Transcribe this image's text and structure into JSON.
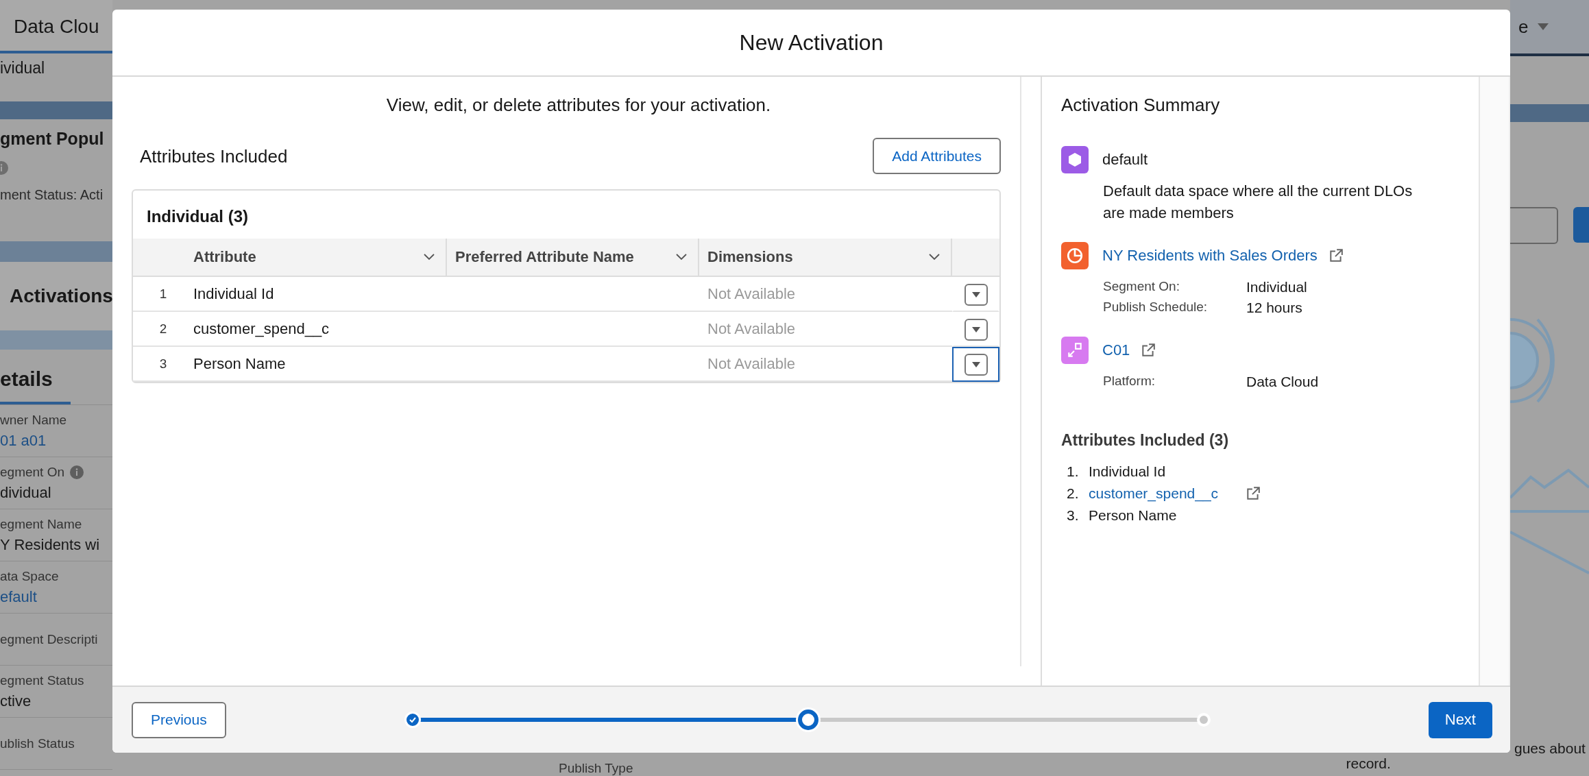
{
  "background": {
    "app_title": "Data Clou",
    "record_type": "ividual",
    "page_title": "gment Popul",
    "status_line": "ment Status: Acti",
    "activations_heading": "Activations",
    "details_tab": "etails",
    "fields": [
      {
        "label": "wner Name",
        "value": "01 a01",
        "link": true,
        "info": false
      },
      {
        "label": "egment On",
        "value": "dividual",
        "link": false,
        "info": true
      },
      {
        "label": "egment Name",
        "value": "Y Residents wi",
        "link": false,
        "info": false
      },
      {
        "label": "ata Space",
        "value": "efault",
        "link": true,
        "info": false
      },
      {
        "label": "egment Descripti",
        "info": false
      },
      {
        "label": "egment Status",
        "value": "ctive",
        "link": false,
        "info": false
      },
      {
        "label": "ublish Status",
        "info": false
      }
    ],
    "header_right": "e",
    "bottom_label": "Publish Type",
    "note_end": "gues about",
    "note_last": "record."
  },
  "modal": {
    "title": "New Activation",
    "instructions": "View, edit, or delete attributes for your activation.",
    "section_title": "Attributes Included",
    "add_button": "Add Attributes",
    "table": {
      "title": "Individual (3)",
      "columns": [
        "Attribute",
        "Preferred Attribute Name",
        "Dimensions"
      ],
      "rows": [
        {
          "number": "1",
          "attribute": "Individual Id",
          "dimensions": "Not Available",
          "focused": false
        },
        {
          "number": "2",
          "attribute": "customer_spend__c",
          "dimensions": "Not Available",
          "focused": false
        },
        {
          "number": "3",
          "attribute": "Person Name",
          "dimensions": "Not Available",
          "focused": true
        }
      ]
    },
    "summary": {
      "title": "Activation Summary",
      "items": [
        {
          "kind": "data_space",
          "color": "#9c5be6",
          "title": "default",
          "link": false,
          "description": "Default data space where all the current DLOs are made members"
        },
        {
          "kind": "segment",
          "color": "#f2612e",
          "title": "NY Residents with Sales Orders",
          "link": true,
          "details": [
            {
              "label": "Segment On:",
              "value": "Individual"
            },
            {
              "label": "Publish Schedule:",
              "value": "12 hours"
            }
          ]
        },
        {
          "kind": "target",
          "color": "#d77af0",
          "title": "C01",
          "link": true,
          "details": [
            {
              "label": "Platform:",
              "value": "Data Cloud"
            }
          ]
        }
      ],
      "attributes_title": "Attributes Included (3)",
      "attributes": [
        {
          "number": "1.",
          "name": "Individual Id",
          "link": false
        },
        {
          "number": "2.",
          "name": "customer_spend__c",
          "link": true
        },
        {
          "number": "3.",
          "name": "Person Name",
          "link": false
        }
      ]
    },
    "footer": {
      "previous": "Previous",
      "next": "Next",
      "progress": {
        "level": 0.5,
        "steps": [
          {
            "kind": "complete"
          },
          {
            "kind": "current"
          },
          {
            "kind": "upcoming"
          }
        ]
      }
    }
  }
}
